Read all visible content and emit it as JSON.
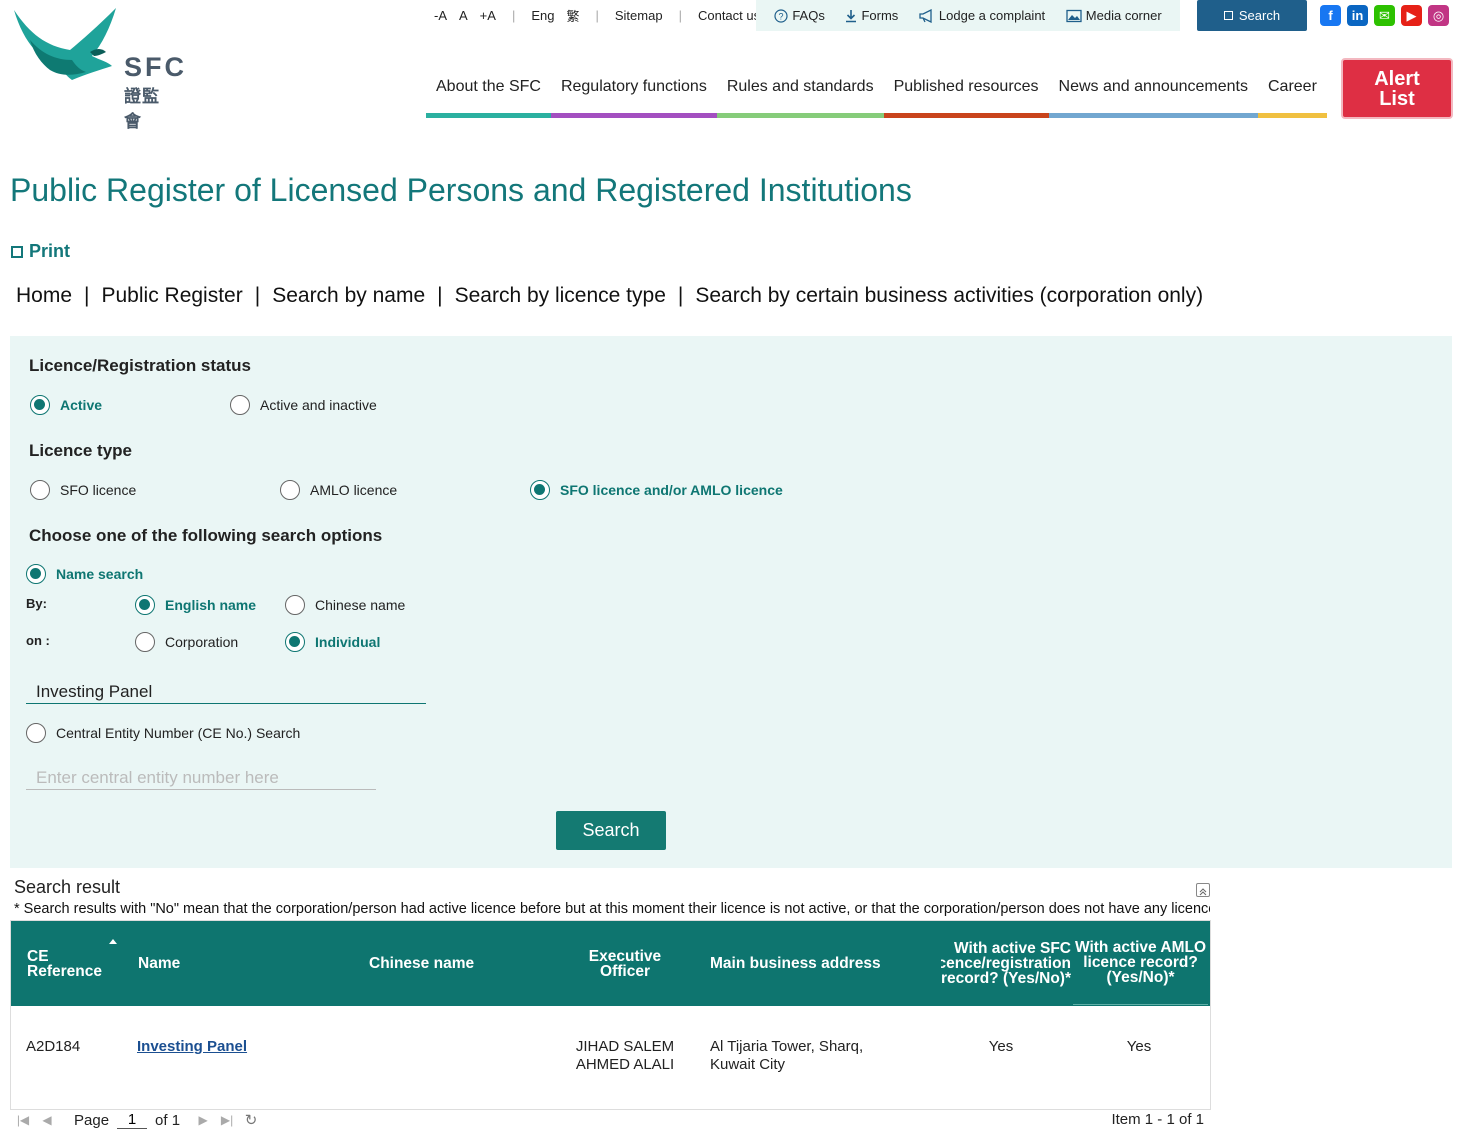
{
  "header": {
    "logo": {
      "en": "SFC",
      "zh": "證監會"
    },
    "utility": {
      "font_small": "-A",
      "font_normal": "A",
      "font_large": "+A",
      "lang_en": "Eng",
      "lang_zh": "繁",
      "sitemap": "Sitemap",
      "contact": "Contact us"
    },
    "utility_group": {
      "faqs": "FAQs",
      "forms": "Forms",
      "complaint": "Lodge a complaint",
      "media": "Media corner"
    },
    "search_label": "Search",
    "social": [
      {
        "name": "facebook",
        "color": "#1877f2",
        "glyph": "f"
      },
      {
        "name": "linkedin",
        "color": "#0a66c2",
        "glyph": "in"
      },
      {
        "name": "wechat",
        "color": "#2dc100",
        "glyph": "✉"
      },
      {
        "name": "youtube",
        "color": "#e62117",
        "glyph": "▶"
      },
      {
        "name": "instagram",
        "color": "#c13584",
        "glyph": "◎"
      }
    ],
    "nav": [
      {
        "label": "About the SFC",
        "color": "#2bb0a0"
      },
      {
        "label": "Regulatory functions",
        "color": "#a34fc0"
      },
      {
        "label": "Rules and standards",
        "color": "#86cc7a"
      },
      {
        "label": "Published resources",
        "color": "#c9441c"
      },
      {
        "label": "News and announcements",
        "color": "#72a7d0"
      },
      {
        "label": "Career",
        "color": "#f0c040"
      }
    ],
    "alert_list": "Alert List"
  },
  "page": {
    "title": "Public Register of Licensed Persons and Registered Institutions",
    "print": "Print",
    "breadcrumb": [
      "Home",
      "Public Register",
      "Search by name",
      "Search by licence type",
      "Search by certain business activities (corporation only)"
    ]
  },
  "form": {
    "status": {
      "title": "Licence/Registration status",
      "active": "Active",
      "active_inactive": "Active and inactive",
      "selected": "active"
    },
    "licence_type": {
      "title": "Licence type",
      "sfo": "SFO licence",
      "amlo": "AMLO licence",
      "both": "SFO licence and/or AMLO licence",
      "selected": "both"
    },
    "options": {
      "title": "Choose one of the following search options",
      "name_search": "Name search",
      "by_label": "By:",
      "english_name": "English name",
      "chinese_name": "Chinese name",
      "on_label": "on :",
      "corporation": "Corporation",
      "individual": "Individual",
      "name_value": "Investing Panel",
      "ce_search": "Central Entity Number (CE No.) Search",
      "ce_placeholder": "Enter central entity number here"
    },
    "search_button": "Search"
  },
  "results": {
    "title": "Search result",
    "note": "* Search results with \"No\" mean that the corporation/person had active licence before but at this moment their licence is not active, or that the corporation/person does not have any licence record.",
    "columns": {
      "ce": "CE Reference",
      "name": "Name",
      "chinese": "Chinese name",
      "officer": "Executive Officer",
      "address": "Main business address",
      "sfc": "With active SFC licence/registration record? (Yes/No)*",
      "amlo": "With active AMLO licence record? (Yes/No)*"
    },
    "rows": [
      {
        "ce": "A2D184",
        "name": "Investing Panel",
        "chinese": "",
        "officer": "JIHAD SALEM AHMED ALALI",
        "address": "Al Tijaria Tower, Sharq, Kuwait City",
        "sfc": "Yes",
        "amlo": "Yes"
      }
    ],
    "pager": {
      "page_label": "Page",
      "page": "1",
      "of_label": "of 1",
      "info": "Item 1 - 1 of 1"
    }
  }
}
